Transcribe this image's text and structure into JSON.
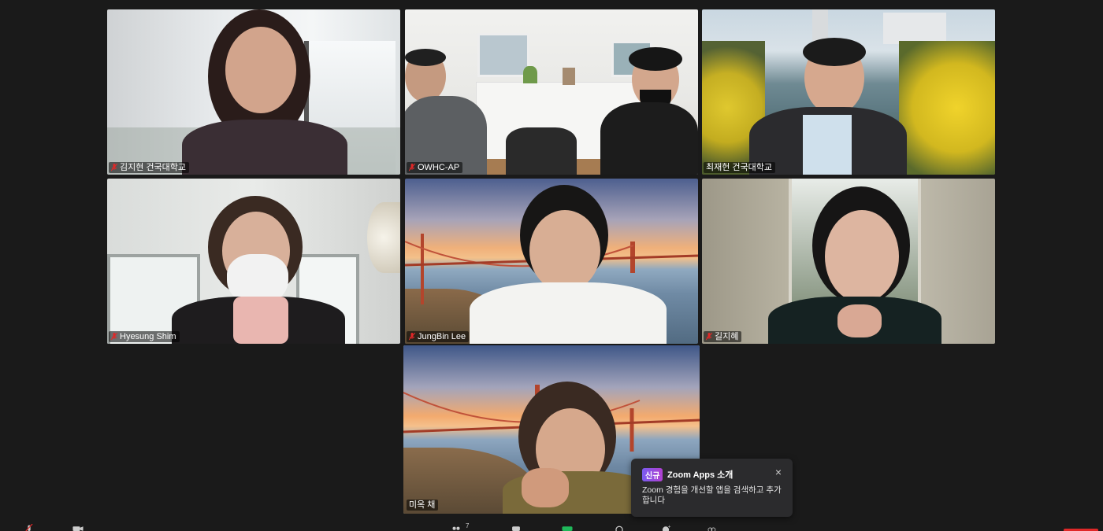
{
  "participants": [
    {
      "name": "김지현 건국대학교",
      "muted": true
    },
    {
      "name": "OWHC-AP",
      "muted": true
    },
    {
      "name": "최재헌 건국대학교",
      "muted": false
    },
    {
      "name": "Hyesung Shim",
      "muted": true
    },
    {
      "name": "JungBin Lee",
      "muted": true
    },
    {
      "name": "길지혜",
      "muted": true
    },
    {
      "name": "미옥 채",
      "muted": false
    }
  ],
  "toast": {
    "badge": "신규",
    "title": "Zoom Apps 소개",
    "body": "Zoom 경험을 개선할 앱을 검색하고 추가합니다",
    "close": "×"
  },
  "toolbar": {
    "participants_count": "7"
  },
  "colors": {
    "active_speaker_border": "#c9e265",
    "mute_red": "#e02828",
    "background": "#1a1a1a"
  }
}
